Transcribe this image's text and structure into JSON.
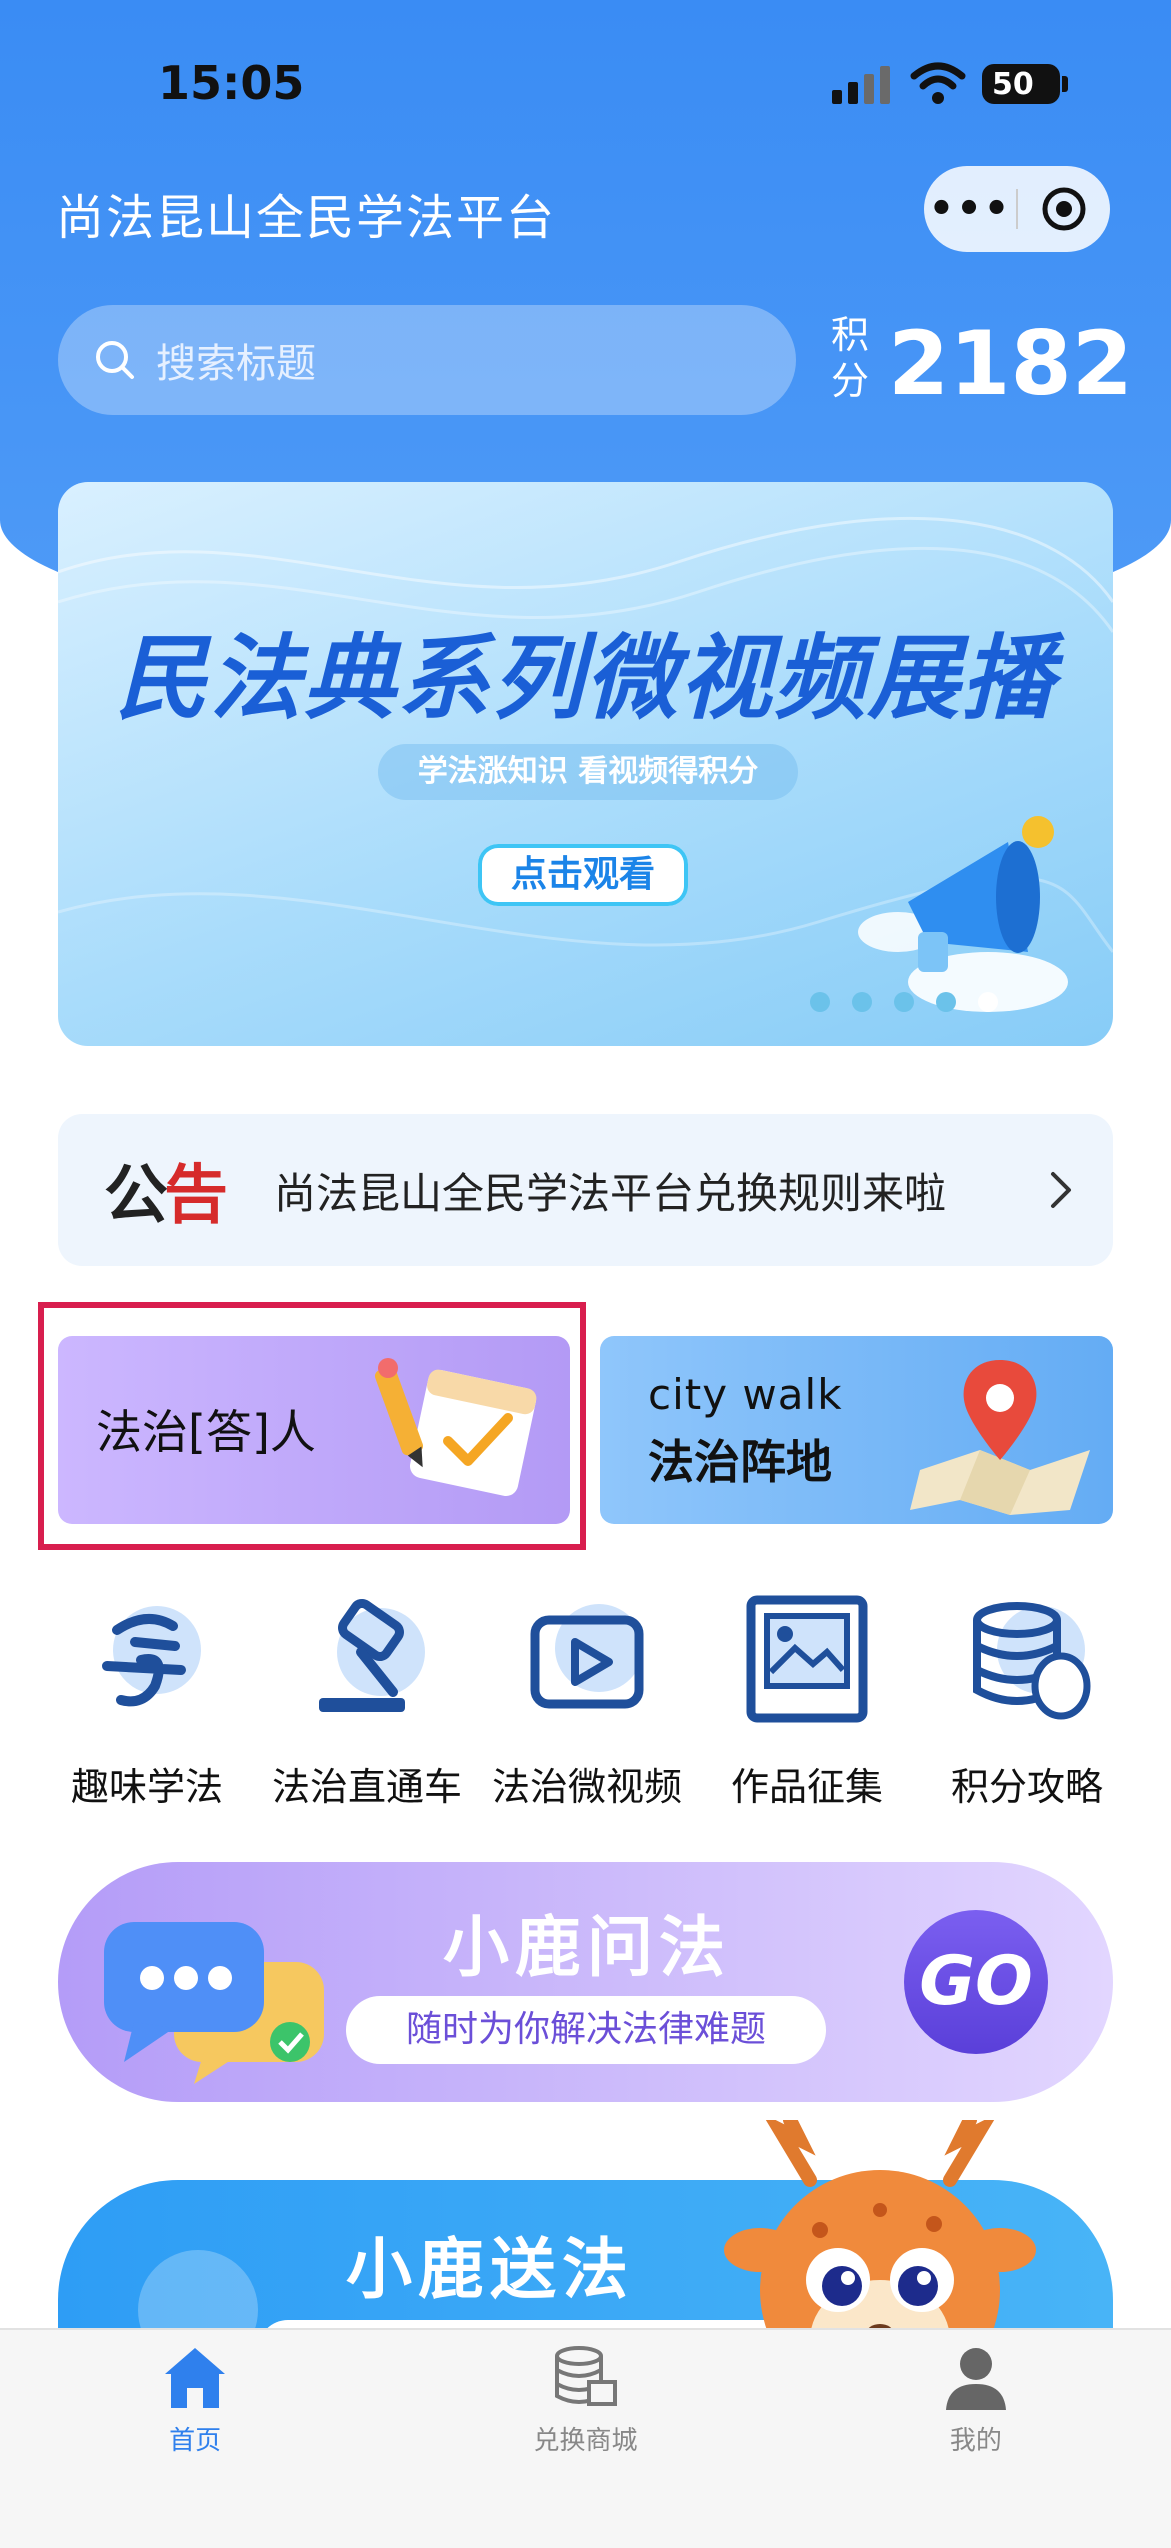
{
  "status_bar": {
    "time": "15:05",
    "battery": "50"
  },
  "header": {
    "app_title": "尚法昆山全民学法平台"
  },
  "search": {
    "placeholder": "搜索标题"
  },
  "points": {
    "label": "积分",
    "value": "2182"
  },
  "banner": {
    "title": "民法典系列微视频展播",
    "subtitle": "学法涨知识 看视频得积分",
    "button": "点击观看",
    "slide_count": 5,
    "active_slide": 5
  },
  "notice": {
    "logo": "公告",
    "text": "尚法昆山全民学法平台兑换规则来啦"
  },
  "feature_cards": [
    {
      "label": "法治[答]人"
    },
    {
      "line1": "city walk",
      "line2": "法治阵地"
    }
  ],
  "quick_entries": [
    {
      "label": "趣味学法",
      "icon": "xue-calligraphy-icon"
    },
    {
      "label": "法治直通车",
      "icon": "gavel-icon"
    },
    {
      "label": "法治微视频",
      "icon": "video-play-icon"
    },
    {
      "label": "作品征集",
      "icon": "picture-frame-icon"
    },
    {
      "label": "积分攻略",
      "icon": "coin-stack-icon"
    }
  ],
  "promos": [
    {
      "title": "小鹿问法",
      "subtitle": "随时为你解决法律难题",
      "button": "GO"
    },
    {
      "title": "小鹿送法"
    }
  ],
  "tabbar": {
    "items": [
      {
        "label": "首页",
        "icon": "home-icon",
        "active": true
      },
      {
        "label": "兑换商城",
        "icon": "shop-database-icon",
        "active": false
      },
      {
        "label": "我的",
        "icon": "person-icon",
        "active": false
      }
    ]
  },
  "colors": {
    "primary": "#3a8cf4",
    "highlight_border": "#d81e4e",
    "notice_red": "#d62b2b",
    "promo_purple": "#b49cf8"
  }
}
